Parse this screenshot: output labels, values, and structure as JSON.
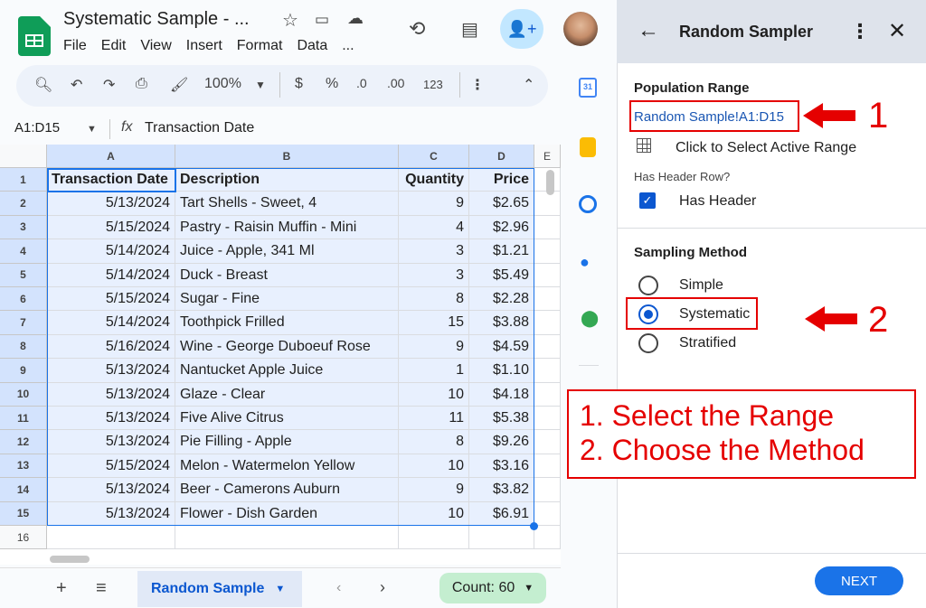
{
  "doc": {
    "title": "Systematic Sample - ...",
    "menus": [
      "File",
      "Edit",
      "View",
      "Insert",
      "Format",
      "Data",
      "..."
    ]
  },
  "toolbar": {
    "zoom": "100%",
    "currency": "$",
    "percent": "%",
    "dec_dec": ".0",
    "inc_dec": ".00",
    "format_123": "123"
  },
  "formula": {
    "namebox": "A1:D15",
    "fx": "fx",
    "content": "Transaction Date"
  },
  "grid": {
    "columns": [
      "A",
      "B",
      "C",
      "D",
      "E"
    ],
    "header": [
      "Transaction Date",
      "Description",
      "Quantity",
      "Price"
    ],
    "row_numbers": [
      "1",
      "2",
      "3",
      "4",
      "5",
      "6",
      "7",
      "8",
      "9",
      "10",
      "11",
      "12",
      "13",
      "14",
      "15",
      "16"
    ],
    "rows": [
      [
        "5/13/2024",
        "Tart Shells - Sweet, 4",
        "9",
        "$2.65"
      ],
      [
        "5/15/2024",
        "Pastry - Raisin Muffin - Mini",
        "4",
        "$2.96"
      ],
      [
        "5/14/2024",
        "Juice - Apple, 341 Ml",
        "3",
        "$1.21"
      ],
      [
        "5/14/2024",
        "Duck - Breast",
        "3",
        "$5.49"
      ],
      [
        "5/15/2024",
        "Sugar - Fine",
        "8",
        "$2.28"
      ],
      [
        "5/14/2024",
        "Toothpick Frilled",
        "15",
        "$3.88"
      ],
      [
        "5/16/2024",
        "Wine - George Duboeuf Rose",
        "9",
        "$4.59"
      ],
      [
        "5/13/2024",
        "Nantucket Apple Juice",
        "1",
        "$1.10"
      ],
      [
        "5/13/2024",
        "Glaze - Clear",
        "10",
        "$4.18"
      ],
      [
        "5/13/2024",
        "Five Alive Citrus",
        "11",
        "$5.38"
      ],
      [
        "5/13/2024",
        "Pie Filling - Apple",
        "8",
        "$9.26"
      ],
      [
        "5/15/2024",
        "Melon - Watermelon Yellow",
        "10",
        "$3.16"
      ],
      [
        "5/13/2024",
        "Beer - Camerons Auburn",
        "9",
        "$3.82"
      ],
      [
        "5/13/2024",
        "Flower - Dish Garden",
        "10",
        "$6.91"
      ]
    ]
  },
  "bottom": {
    "sheet_tab": "Random Sample",
    "count": "Count: 60"
  },
  "panel": {
    "title": "Random Sampler",
    "population_range_heading": "Population Range",
    "range_link": "Random Sample!A1:D15",
    "select_active_range": "Click to Select Active Range",
    "has_header_question": "Has Header Row?",
    "has_header_label": "Has Header",
    "sampling_method_heading": "Sampling Method",
    "methods": [
      "Simple",
      "Systematic",
      "Stratified"
    ],
    "selected_method": "Systematic",
    "next_label": "NEXT"
  },
  "annotations": {
    "num1": "1",
    "num2": "2",
    "line1": "1. Select the Range",
    "line2": "2. Choose the Method",
    "color": "#e50000"
  }
}
